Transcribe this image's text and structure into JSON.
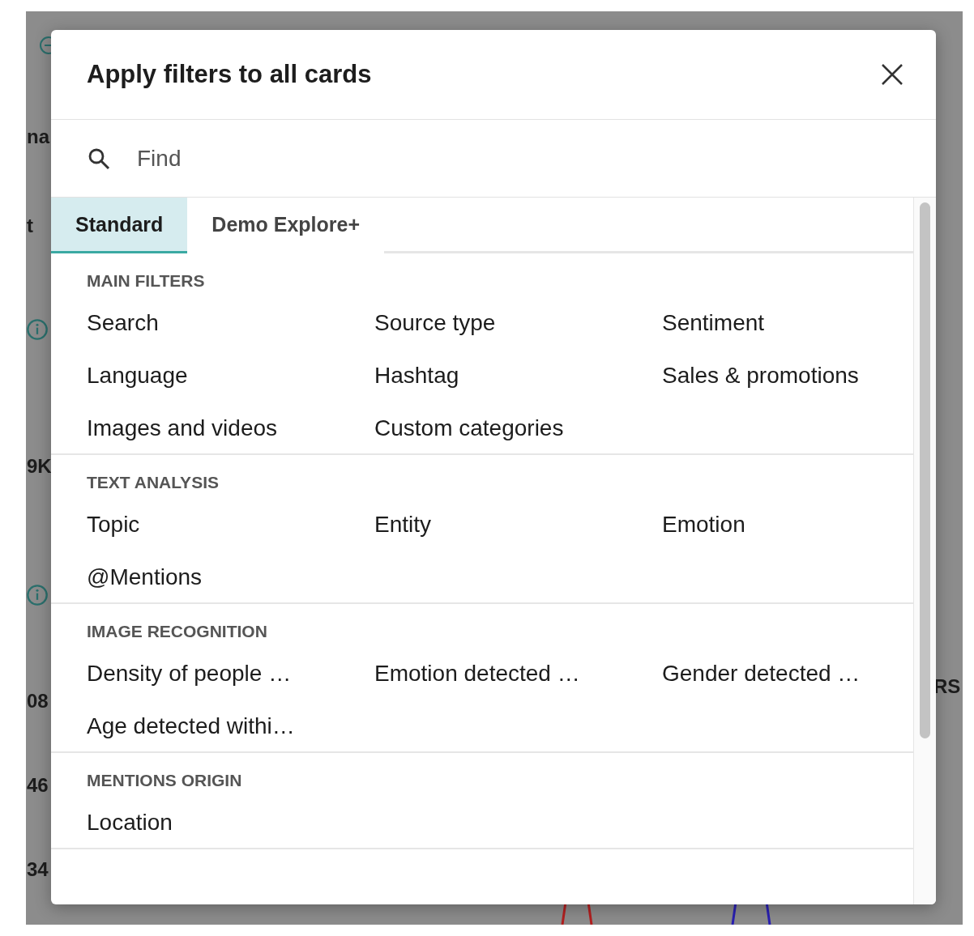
{
  "background": {
    "left_texts": [
      "na",
      "t",
      "9K",
      "08",
      "46",
      "34"
    ],
    "right_texts": [
      "RS"
    ]
  },
  "dialog": {
    "title": "Apply filters to all cards",
    "search": {
      "placeholder": "Find"
    },
    "tabs": [
      {
        "label": "Standard",
        "selected": true
      },
      {
        "label": "Demo Explore+",
        "selected": false
      }
    ],
    "sections": [
      {
        "heading": "MAIN FILTERS",
        "items": [
          "Search",
          "Source type",
          "Sentiment",
          "Language",
          "Hashtag",
          "Sales & promotions",
          "Images and videos",
          "Custom categories"
        ]
      },
      {
        "heading": "TEXT ANALYSIS",
        "items": [
          "Topic",
          "Entity",
          "Emotion",
          "@Mentions"
        ]
      },
      {
        "heading": "IMAGE RECOGNITION",
        "items": [
          "Density of people …",
          "Emotion detected …",
          "Gender detected …",
          "Age detected withi…"
        ]
      },
      {
        "heading": "MENTIONS ORIGIN",
        "items": [
          "Location"
        ]
      }
    ]
  }
}
